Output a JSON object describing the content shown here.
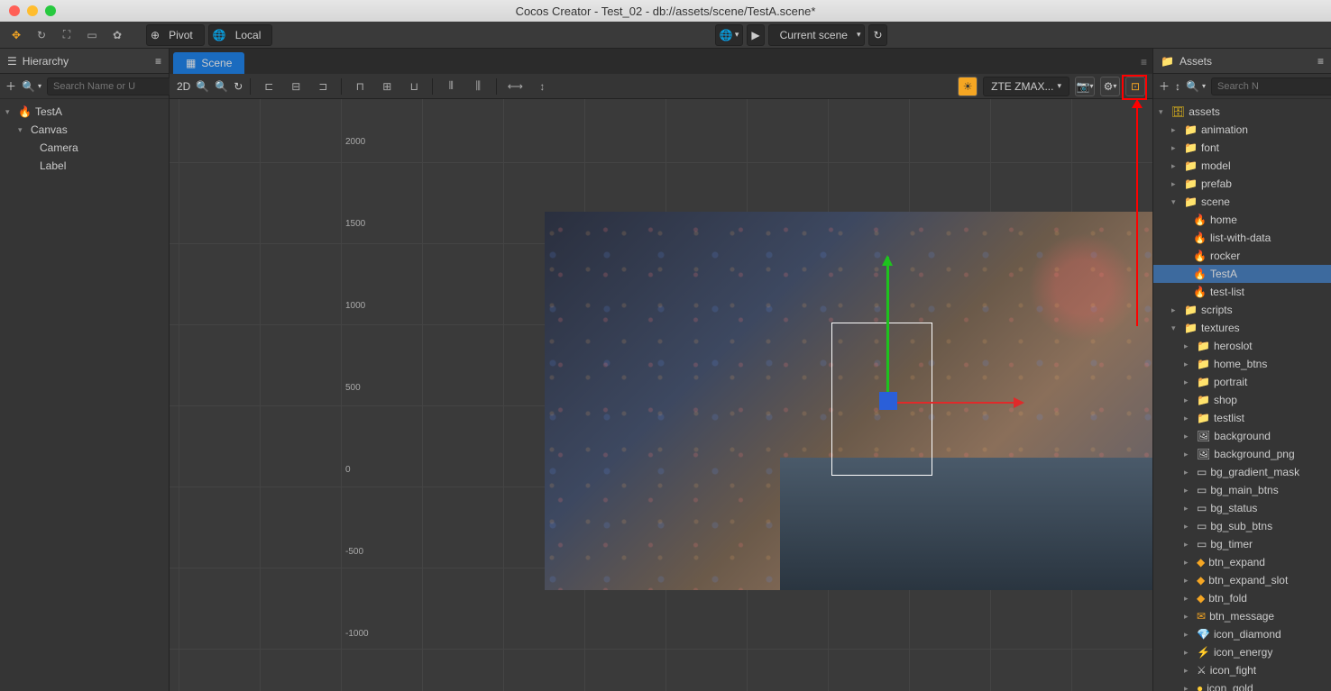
{
  "window": {
    "title": "Cocos Creator - Test_02 - db://assets/scene/TestA.scene*"
  },
  "toolbar": {
    "pivot": "Pivot",
    "local": "Local",
    "scene_dd": "Current scene"
  },
  "hierarchy": {
    "title": "Hierarchy",
    "search_ph": "Search Name or U",
    "root": "TestA",
    "canvas": "Canvas",
    "camera": "Camera",
    "label": "Label"
  },
  "scene": {
    "tab": "Scene",
    "mode2d": "2D",
    "device": "ZTE ZMAX..."
  },
  "ruler": {
    "r0": "2000",
    "r1": "1500",
    "r2": "1000",
    "r3": "500",
    "r4": "0",
    "r5": "-500",
    "r6": "-1000"
  },
  "assets": {
    "title": "Assets",
    "search_ph": "Search N",
    "root": "assets",
    "folders": {
      "animation": "animation",
      "font": "font",
      "model": "model",
      "prefab": "prefab",
      "scene": "scene",
      "scripts": "scripts",
      "textures": "textures"
    },
    "scenes": {
      "home": "home",
      "list": "list-with-data",
      "rocker": "rocker",
      "testa": "TestA",
      "testlist": "test-list"
    },
    "tex": {
      "heroslot": "heroslot",
      "home_btns": "home_btns",
      "portrait": "portrait",
      "shop": "shop",
      "testlist": "testlist",
      "background": "background",
      "background_png": "background_png",
      "bg_gradient": "bg_gradient_mask",
      "bg_main": "bg_main_btns",
      "bg_status": "bg_status",
      "bg_sub": "bg_sub_btns",
      "bg_timer": "bg_timer",
      "btn_expand": "btn_expand",
      "btn_expand_slot": "btn_expand_slot",
      "btn_fold": "btn_fold",
      "btn_message": "btn_message",
      "icon_diamond": "icon_diamond",
      "icon_energy": "icon_energy",
      "icon_fight": "icon_fight",
      "icon_gold": "icon_gold"
    }
  }
}
